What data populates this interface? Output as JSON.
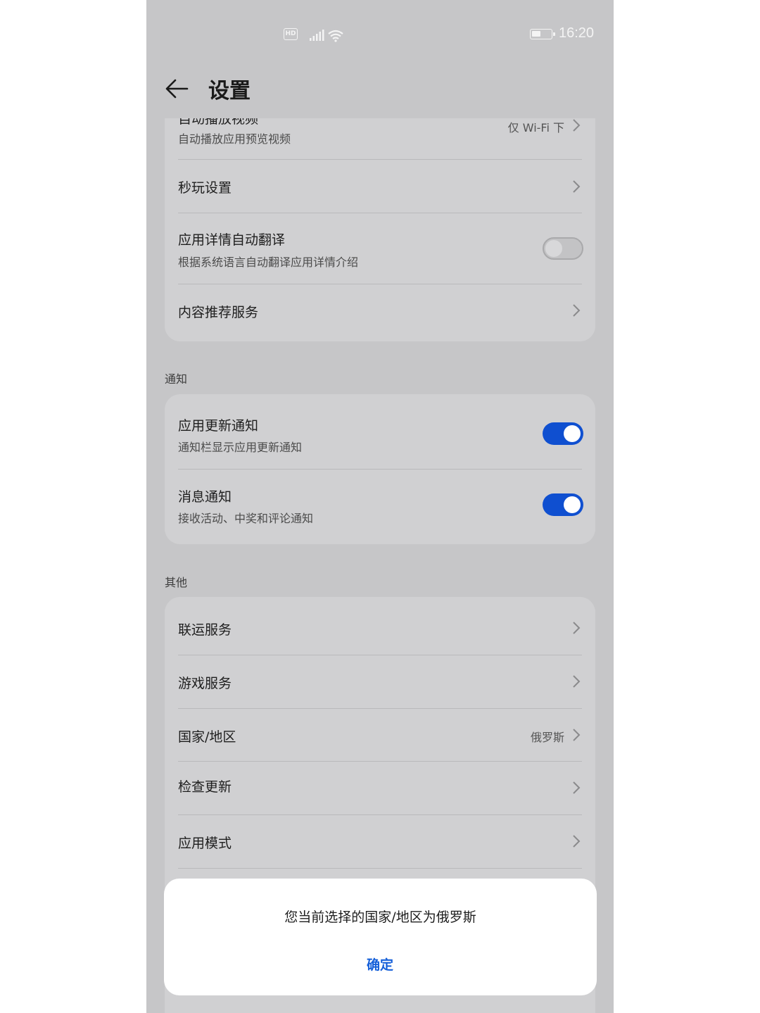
{
  "status_bar": {
    "hd_label": "HD",
    "time": "16:20"
  },
  "header": {
    "title": "设置"
  },
  "card1": {
    "autoplay": {
      "title": "自动播放视频",
      "subtitle": "自动播放应用预览视频",
      "value": "仅 Wi-Fi 下"
    },
    "instant_play": {
      "title": "秒玩设置"
    },
    "auto_translate": {
      "title": "应用详情自动翻译",
      "subtitle": "根据系统语言自动翻译应用详情介绍",
      "enabled": false
    },
    "recommend": {
      "title": "内容推荐服务"
    }
  },
  "notify_section": {
    "label": "通知",
    "update_notify": {
      "title": "应用更新通知",
      "subtitle": "通知栏显示应用更新通知",
      "enabled": true
    },
    "message_notify": {
      "title": "消息通知",
      "subtitle": "接收活动、中奖和评论通知",
      "enabled": true
    }
  },
  "other_section": {
    "label": "其他",
    "items": [
      {
        "title": "联运服务",
        "value": ""
      },
      {
        "title": "游戏服务",
        "value": ""
      },
      {
        "title": "国家/地区",
        "value": "俄罗斯"
      },
      {
        "title": "检查更新",
        "value": ""
      },
      {
        "title": "应用模式",
        "value": ""
      }
    ]
  },
  "dialog": {
    "message": "您当前选择的国家/地区为俄罗斯",
    "confirm_label": "确定"
  },
  "colors": {
    "accent": "#1660d9",
    "switch_on": "#0f4fd0",
    "backdrop": "#c6c6c8"
  }
}
